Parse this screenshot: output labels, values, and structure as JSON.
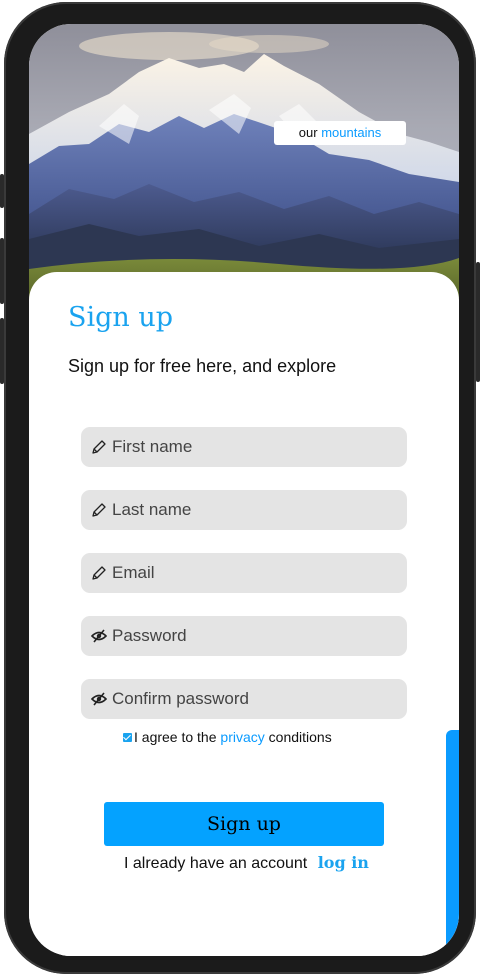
{
  "hero": {
    "tag_prefix": "our",
    "tag_accent": "mountains"
  },
  "signup": {
    "title": "Sign up",
    "subtitle": "Sign up for free here, and explore"
  },
  "fields": [
    {
      "placeholder": "First name",
      "value": "",
      "icon": "pencil-icon"
    },
    {
      "placeholder": "Last name",
      "value": "",
      "icon": "pencil-icon"
    },
    {
      "placeholder": "Email",
      "value": "",
      "icon": "pencil-icon"
    },
    {
      "placeholder": "Password",
      "value": "",
      "icon": "eye-slash-icon"
    },
    {
      "placeholder": "Confirm password",
      "value": "",
      "icon": "eye-slash-icon"
    }
  ],
  "agree": {
    "checked": true,
    "prefix": "I agree to the",
    "link": "privacy",
    "suffix": "conditions"
  },
  "button": {
    "label": "Sign up"
  },
  "footer": {
    "text": "I already have an account",
    "login_link": "log in"
  },
  "colors": {
    "accent": "#0a9bff",
    "field_bg": "#e4e4e4",
    "button_bg": "#04a2ff"
  }
}
